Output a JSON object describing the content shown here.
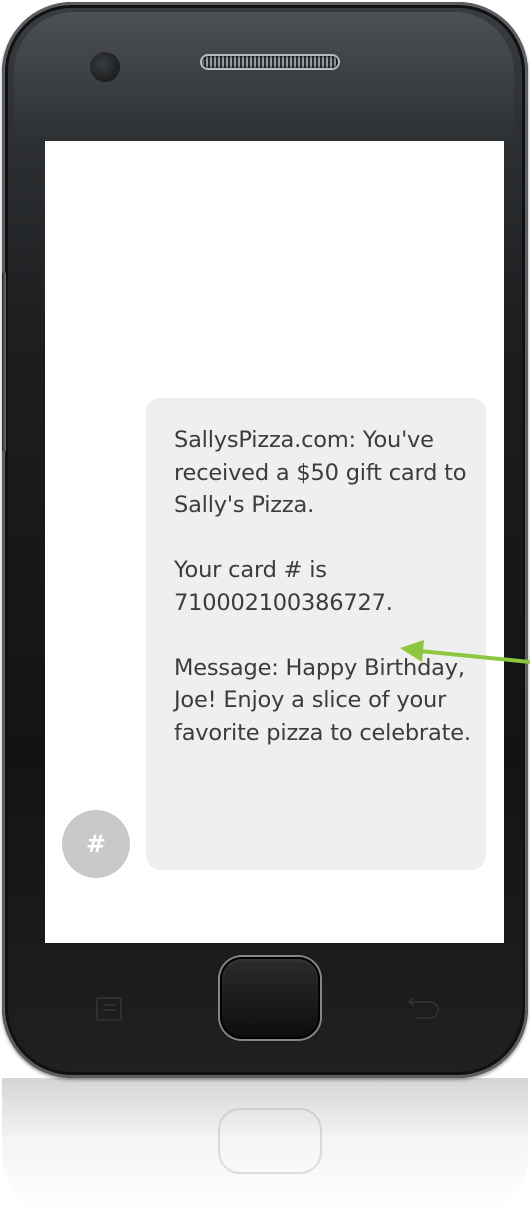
{
  "message": {
    "text": "SallysPizza.com: You've received a $50 gift card to Sally's Pizza.\n\nYour card # is 710002100386727.\n\nMessage: Happy Birthday, Joe! Enjoy a slice of your favorite pizza to celebrate.",
    "sender_avatar_label": "#"
  },
  "colors": {
    "bubble_background": "#efefef",
    "avatar_background": "#c9c9c9",
    "arrow": "#8dc63f",
    "phone_body": "#1c1e20"
  },
  "icons": {
    "menu": "menu-key-icon",
    "back": "back-key-icon",
    "arrow": "arrow-icon"
  }
}
